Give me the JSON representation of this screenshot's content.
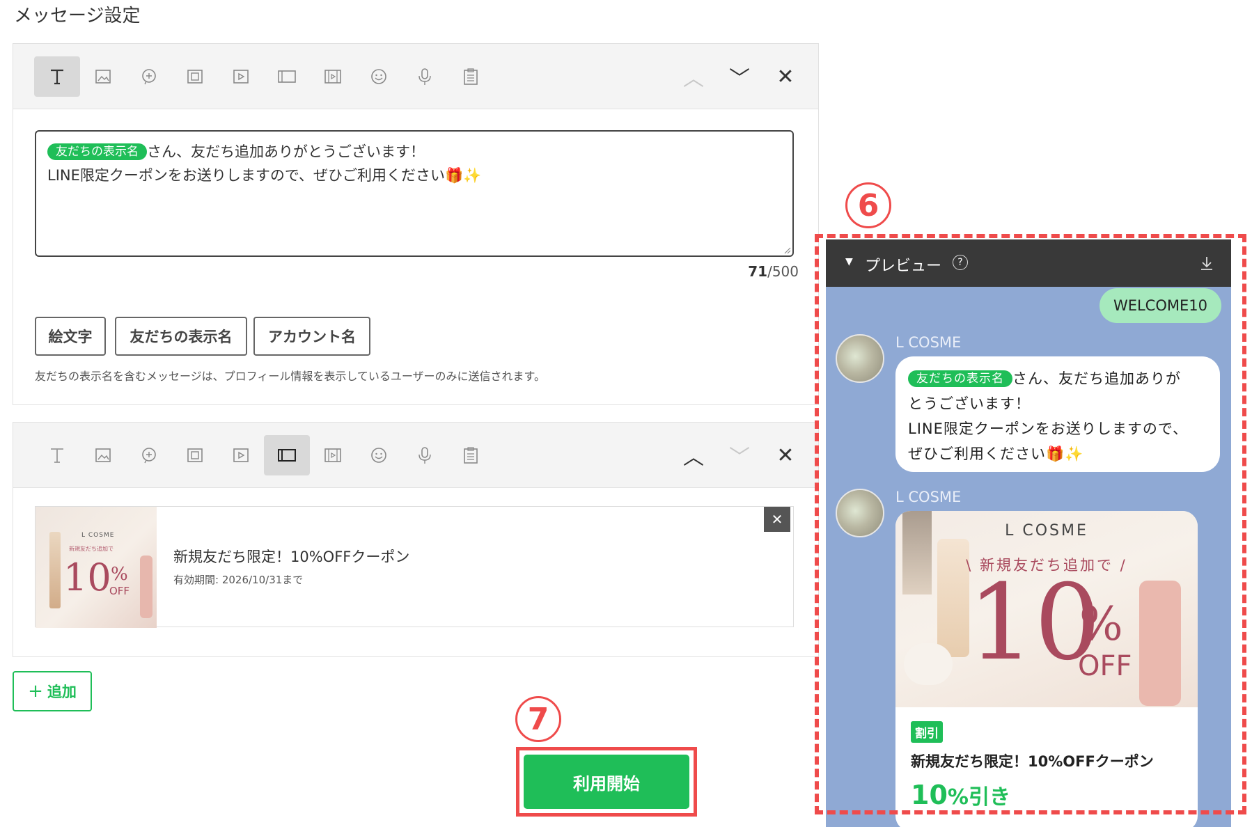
{
  "page": {
    "title": "メッセージ設定"
  },
  "block1": {
    "message_tag": "友だちの表示名",
    "message_line1": "さん、友だち追加ありがとうございます！",
    "message_line2": "LINE限定クーポンをお送りしますので、ぜひご利用ください🎁✨",
    "counter_current": "71",
    "counter_max": "/500",
    "insert_buttons": [
      "絵文字",
      "友だちの表示名",
      "アカウント名"
    ],
    "note": "友だちの表示名を含むメッセージは、プロフィール情報を表示しているユーザーのみに送信されます。"
  },
  "block2": {
    "coupon_title": "新規友だち限定！10%OFFクーポン",
    "coupon_validity": "有効期間: 2026/10/31まで",
    "thumb_brand": "L COSME",
    "thumb_sub": "新規友だち追加で",
    "thumb_big": "10",
    "thumb_pct": "%",
    "thumb_off": "OFF"
  },
  "add_button": "追加",
  "start_button": "利用開始",
  "annotations": {
    "six": "6",
    "seven": "7"
  },
  "preview": {
    "header": "プレビュー",
    "user_bubble": "WELCOME10",
    "sender": "L COSME",
    "tag": "友だちの表示名",
    "text1": "さん、友だち追加ありが",
    "text2": "とうございます！",
    "text3": "LINE限定クーポンをお送りしますので、",
    "text4": "ぜひご利用ください🎁✨",
    "coupon_brand": "L COSME",
    "coupon_sub": "\\ 新規友だち追加で /",
    "coupon_big": "10",
    "coupon_pct": "%",
    "coupon_off": "OFF",
    "coupon_badge": "割引",
    "coupon_title": "新規友だち限定！10%OFFクーポン",
    "coupon_value": "10",
    "coupon_value_unit": "%引き"
  },
  "colors": {
    "brand_green": "#1fbe58",
    "annotation_red": "#ef4b4b",
    "preview_bg": "#8fa9d4"
  }
}
